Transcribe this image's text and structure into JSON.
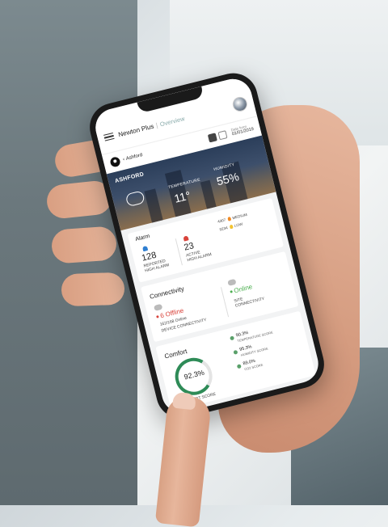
{
  "app": {
    "brand": "Newton Plus",
    "section": "Overview",
    "date_label": "Date from",
    "date_value": "01/01/2019"
  },
  "location": {
    "name": "Ashford"
  },
  "hero": {
    "site": "ASHFORD",
    "temperature_label": "TEMPERATURE",
    "temperature_value": "11°",
    "humidity_label": "HUMIDITY",
    "humidity_value": "55%"
  },
  "alarm": {
    "title": "Alarm",
    "reported_count": "128",
    "reported_label_1": "REPORTED",
    "reported_label_2": "HIGH ALARM",
    "active_count": "23",
    "active_label_1": "ACTIVE",
    "active_label_2": "HIGH ALARM",
    "medium_count": "4307",
    "medium_label": "MEDIUM",
    "low_count": "9234",
    "low_label": "LOW"
  },
  "connectivity": {
    "title": "Connectivity",
    "offline_text": "6 Offline",
    "online_summary": "162/168 Online",
    "device_label": "DEVICE CONNECTIVITY",
    "site_status": "Online",
    "site_label_1": "SITE",
    "site_label_2": "CONNECTIVITY"
  },
  "comfort": {
    "title": "Comfort",
    "score": "92.3%",
    "score_label": "COMFORT SCORE",
    "gauge_fraction": 0.923,
    "temperature_score": "90.3%",
    "temperature_label": "TEMPERATURE SCORE",
    "humidity_score": "95.3%",
    "humidity_label": "HUMIDITY SCORE",
    "co2_score": "89.0%",
    "co2_label": "CO2 SCORE"
  },
  "colors": {
    "offline": "#d9433b",
    "online": "#4caf50",
    "alarm_reported": "#2f7fd1",
    "alarm_active": "#d9433b",
    "medium": "#f08a24",
    "low": "#f2c230",
    "comfort_gauge": "#2e8b57"
  }
}
